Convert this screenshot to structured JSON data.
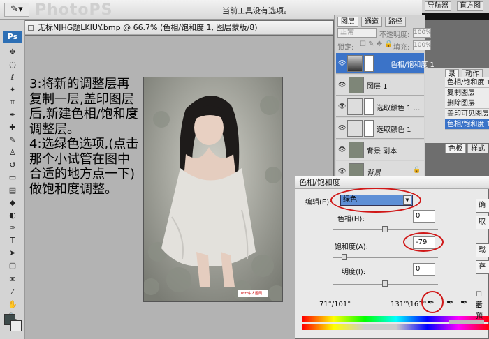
{
  "options_bar": {
    "tool_icon": "brush-tool-icon",
    "watermark": "PhotoPS",
    "status": "当前工具没有选项。"
  },
  "top_nav": {
    "tabs": [
      "导航器",
      "直方图"
    ]
  },
  "toolbar": {
    "logo": "Ps"
  },
  "document": {
    "title": "无标NJHG题LKIUY.bmp @ 66.7% (色相/饱和度 1, 图层蒙版/8)"
  },
  "instructions": "3:将新的调整层再复制一层,盖印图层后,新建色相/饱和度调整层。\n4:选绿色选项,(点击那个小试管在图中合适的地方点一下)做饱和度调整。",
  "photo": {
    "watermark": "16fx中人图网"
  },
  "layers_panel": {
    "tabs": [
      "图层",
      "通道",
      "路径"
    ],
    "blend_mode": "正常",
    "opacity_label": "不透明度:",
    "opacity_value": "100%",
    "lock_label": "锁定:",
    "fill_label": "填充:",
    "fill_value": "100%",
    "layers": [
      {
        "name": "色相/饱和度 1",
        "type": "adjustment",
        "selected": true
      },
      {
        "name": "图层 1",
        "type": "image",
        "selected": false
      },
      {
        "name": "选取颜色 1 ...",
        "type": "adjustment",
        "selected": false
      },
      {
        "name": "选取颜色 1",
        "type": "adjustment",
        "selected": false
      },
      {
        "name": "背景 副本",
        "type": "image",
        "selected": false
      },
      {
        "name": "背景",
        "type": "image",
        "selected": false
      }
    ]
  },
  "history_panel": {
    "tabs": [
      "录",
      "动作"
    ],
    "items": [
      "色相/饱和度 1",
      "复制图层",
      "删除图层",
      "盖印可见图层",
      "色相/饱和度 1"
    ],
    "selected_index": 4
  },
  "color_panel": {
    "tabs": [
      "色板",
      "样式"
    ]
  },
  "hue_sat_dialog": {
    "title": "色相/饱和度",
    "edit_label": "编辑(E):",
    "edit_value": "绿色",
    "hue_label": "色相(H):",
    "hue_value": "0",
    "sat_label": "饱和度(A):",
    "sat_value": "-79",
    "light_label": "明度(I):",
    "light_value": "0",
    "range_left": "71°/101°",
    "range_right": "131°\\161°",
    "button_labels": [
      "确",
      "取",
      "载",
      "存"
    ],
    "colorize_label": "着",
    "preview_label": "预"
  },
  "colors": {
    "accent": "#3b73c8",
    "highlight_ring": "#d01818"
  }
}
